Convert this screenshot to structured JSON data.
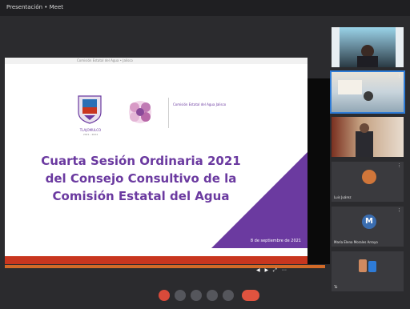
{
  "window": {
    "title": "Presentación • Meet"
  },
  "slide": {
    "header_text": "Comisión Estatal del Agua • Jalisco",
    "gov_label": "TLAJOMULCO",
    "gov_sub": "2021 - 2024",
    "agency_text": "Comisión Estatal del Agua Jalisco",
    "title_line1": "Cuarta Sesión Ordinaria 2021",
    "title_line2": "del Consejo Consultivo de la",
    "title_line3": "Comisión Estatal del Agua",
    "date": "8 de septiembre de 2021",
    "nav_text": "◀ ▶ ⤢ ⋯",
    "accent_color": "#6b3aa0",
    "stripe_color": "#c8361f"
  },
  "participants": [
    {
      "name": "",
      "kind": "video"
    },
    {
      "name": "",
      "kind": "video"
    },
    {
      "name": "",
      "kind": "video"
    },
    {
      "name": "Luis Juárez",
      "kind": "avatar",
      "avatar_color": "#d0763a"
    },
    {
      "name": "María Elena Morales Arroyo",
      "kind": "avatar",
      "avatar_color": "#3a6db0",
      "initial": "M"
    },
    {
      "name": "Tú",
      "kind": "avatar",
      "avatar_color": "#2e7bd6"
    }
  ],
  "toolbar": {
    "icons": [
      "mic-off-icon",
      "camera-icon",
      "captions-icon",
      "present-icon",
      "more-icon",
      "end-call-icon"
    ]
  }
}
